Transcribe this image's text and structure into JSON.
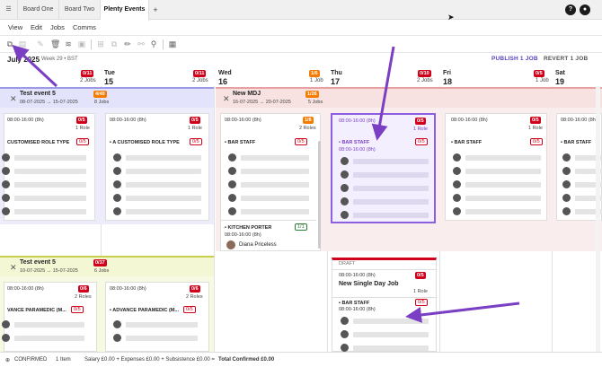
{
  "tabs": [
    "Board One",
    "Board Two",
    "Plenty Events"
  ],
  "tab_add": "+",
  "help_icon": "?",
  "menu": [
    "View",
    "Edit",
    "Jobs",
    "Comms"
  ],
  "header": {
    "month": "July 2025",
    "week": "Week 29 • BST",
    "publish": "PUBLISH 1 JOB",
    "revert": "REVERT 1 JOB"
  },
  "days": [
    {
      "name": "n",
      "num": "",
      "ratio": "",
      "jobs": ""
    },
    {
      "name": "Tue",
      "num": "15",
      "ratio": "0/11",
      "jobs": "2 Jobs"
    },
    {
      "name": "Wed",
      "num": "16",
      "ratio": "1/6",
      "jobs": "1 Job"
    },
    {
      "name": "Thu",
      "num": "17",
      "ratio": "0/10",
      "jobs": "2 Jobs"
    },
    {
      "name": "Fri",
      "num": "18",
      "ratio": "0/5",
      "jobs": "1 Job"
    },
    {
      "name": "Sat",
      "num": "19",
      "ratio": "0/5",
      "jobs": ""
    }
  ],
  "first_day_ratio": "0/11",
  "first_day_jobs": "2 Jobs",
  "events": {
    "test_event_1": {
      "title": "Test event 5",
      "dates": "08-07-2025 → 15-07-2025",
      "badge": "4/40",
      "jobs": "8 Jobs"
    },
    "new_mdj": {
      "title": "New MDJ",
      "dates": "16-07-2025 → 20-07-2025",
      "badge": "1/26",
      "jobs": "5 Jobs"
    },
    "test_event_2": {
      "title": "Test event 5",
      "dates": "10-07-2025 → 15-07-2025",
      "badge": "0/37",
      "jobs": "6 Jobs"
    }
  },
  "cards": {
    "mon": {
      "time": "08:00-16:00 (8h)",
      "badge": "0/5",
      "roles": "1 Role",
      "role": "CUSTOMISED ROLE TYPE",
      "rbadge": "0/5"
    },
    "tue": {
      "time": "08:00-16:00 (8h)",
      "badge": "0/5",
      "roles": "1 Role",
      "role": "• A CUSTOMISED ROLE TYPE",
      "rbadge": "0/5"
    },
    "wed": {
      "time": "08:00-16:00 (8h)",
      "badge": "1/6",
      "roles": "2 Roles",
      "role": "• BAR STAFF",
      "rbadge": "0/5",
      "role2": "• KITCHEN PORTER",
      "rbadge2": "1/1",
      "role2_time": "08:00-16:00 (8h)",
      "assignee": "Diana Priceless"
    },
    "thu": {
      "time": "08:00-16:00 (8h)",
      "badge": "0/5",
      "roles": "1 Role",
      "role": "• BAR STAFF",
      "rbadge": "0/5",
      "role_time": "08:00-16:00 (8h)"
    },
    "fri": {
      "time": "08:00-16:00 (8h)",
      "badge": "0/5",
      "roles": "1 Role",
      "role": "• BAR STAFF",
      "rbadge": "0/5"
    },
    "sat": {
      "time": "08:00-16:00 (8h)",
      "badge": "0/5",
      "roles": "1 Role",
      "role": "• BAR STAFF"
    },
    "mon2": {
      "time": "08:00-16:00 (8h)",
      "badge": "0/6",
      "roles": "2 Roles",
      "role": "VANCE PARAMEDIC (M...",
      "rbadge": "0/5"
    },
    "tue2": {
      "time": "08:00-16:00 (8h)",
      "badge": "0/6",
      "roles": "2 Roles",
      "role": "• ADVANCE PARAMEDIC (M...",
      "rbadge": "0/5"
    },
    "draft": {
      "label": "DRAFT",
      "time": "08:00-16:00 (8h)",
      "badge": "0/5",
      "title": "New Single Day Job",
      "roles": "1 Role",
      "role": "• BAR STAFF",
      "rbadge": "0/5",
      "role_time": "08:00-16:00 (8h)"
    }
  },
  "footer": {
    "confirmed": "CONFIRMED",
    "items": "1 Item",
    "salary": "Salary £0.00 + Expenses £0.00 + Subsistence £0.00 =",
    "total": "Total Confirmed £0.00"
  },
  "colors": {
    "accent": "#7b3fc4",
    "red": "#d0021b",
    "orange": "#f57c00",
    "band_blue": "#e3e3fb",
    "band_red": "#f7e1e1",
    "band_yellow": "#f4f7d3"
  }
}
